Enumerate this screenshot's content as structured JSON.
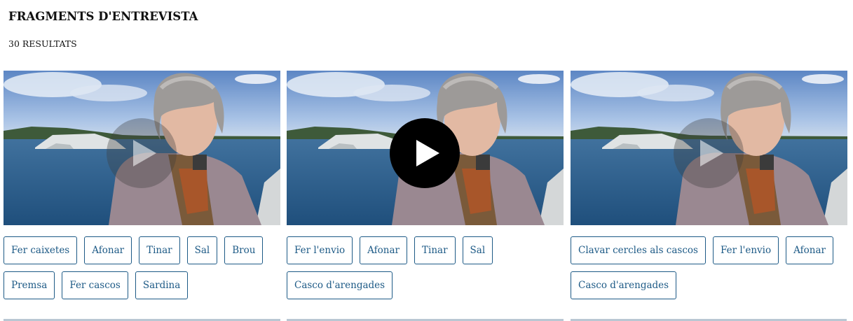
{
  "header": {
    "title": "FRAGMENTS D'ENTREVISTA",
    "results": "30 RESULTATS"
  },
  "colors": {
    "tag_border": "#1d5a86",
    "tag_text": "#1d5a86",
    "play_active": "#000000"
  },
  "cards": [
    {
      "play_icon": "play-icon",
      "play_active": false,
      "tags": [
        "Fer caixetes",
        "Afonar",
        "Tinar",
        "Sal",
        "Brou",
        "Premsa",
        "Fer cascos",
        "Sardina"
      ]
    },
    {
      "play_icon": "play-icon",
      "play_active": true,
      "tags": [
        "Fer l'envio",
        "Afonar",
        "Tinar",
        "Sal",
        "Casco d'arengades"
      ]
    },
    {
      "play_icon": "play-icon",
      "play_active": false,
      "tags": [
        "Clavar cercles als cascos",
        "Fer l'envio",
        "Afonar",
        "Casco d'arengades"
      ]
    }
  ]
}
